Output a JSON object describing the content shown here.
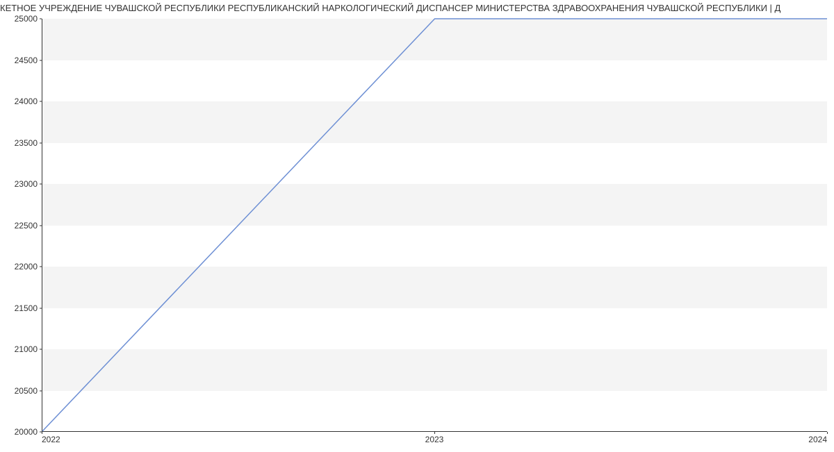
{
  "chart_data": {
    "type": "line",
    "title": "КЕТНОЕ УЧРЕЖДЕНИЕ ЧУВАШСКОЙ РЕСПУБЛИКИ РЕСПУБЛИКАНСКИЙ НАРКОЛОГИЧЕСКИЙ ДИСПАНСЕР МИНИСТЕРСТВА ЗДРАВООХРАНЕНИЯ ЧУВАШСКОЙ РЕСПУБЛИКИ | Д",
    "x": [
      2022,
      2023,
      2024
    ],
    "values": [
      20000,
      25000,
      25000
    ],
    "x_ticks": [
      2022,
      2023,
      2024
    ],
    "y_ticks": [
      20000,
      20500,
      21000,
      21500,
      22000,
      22500,
      23000,
      23500,
      24000,
      24500,
      25000
    ],
    "xlim": [
      2022,
      2024
    ],
    "ylim": [
      20000,
      25000
    ],
    "xlabel": "",
    "ylabel": ""
  }
}
